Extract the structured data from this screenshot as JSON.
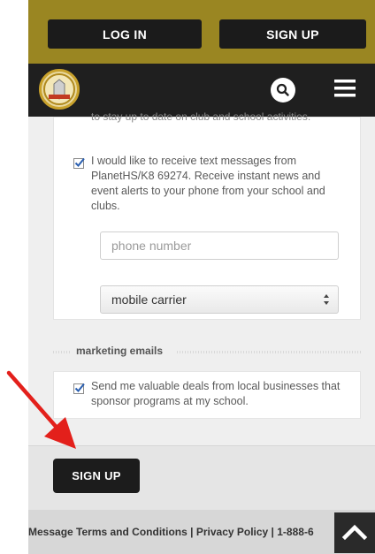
{
  "header": {
    "login_label": "LOG IN",
    "signup_label": "SIGN UP"
  },
  "nav": {
    "logo_icon": "school-seal-logo",
    "search_icon": "search-icon",
    "menu_icon": "hamburger-menu-icon"
  },
  "form": {
    "clipped_text": "to stay up to date on club and school activities.",
    "sms_checkbox": {
      "checked": true,
      "text": "I would like to receive text messages from PlanetHS/K8 69274. Receive instant news and event alerts to your phone from your school and clubs."
    },
    "phone_placeholder": "phone number",
    "carrier_selected": "mobile carrier",
    "marketing_section_title": "marketing emails",
    "marketing_checkbox": {
      "checked": true,
      "text": "Send me valuable deals from local businesses that sponsor programs at my school."
    },
    "submit_label": "SIGN UP"
  },
  "footer": {
    "text": "Message Terms and Conditions | Privacy Policy | 1-888-6"
  },
  "colors": {
    "header_gold": "#9a8622",
    "nav_dark": "#1f1f1f",
    "annotation_red": "#e3201b"
  }
}
